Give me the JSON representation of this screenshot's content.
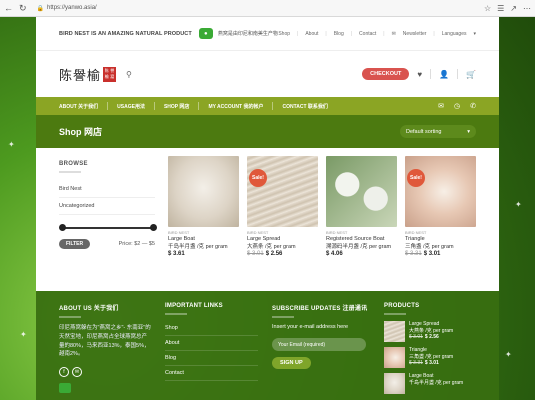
{
  "browser": {
    "url": "https://yanwo.asia/"
  },
  "topbar": {
    "promo": "BIRD NEST IS AN AMAZING NATURAL PRODUCT",
    "wechat_text": "燕窝是由印尼和南美生产物",
    "links": [
      "Shop",
      "About",
      "Blog",
      "Contact",
      "Newsletter",
      "Languages"
    ]
  },
  "header": {
    "logo_text": "陈譽榆",
    "seal_chars": [
      "陈",
      "譽",
      "榆",
      "窩"
    ],
    "checkout_label": "CHECKOUT"
  },
  "mainnav": {
    "items": [
      "ABOUT 关于我们",
      "USAGE用法",
      "SHOP 网店",
      "MY ACCOUNT 我的帐户",
      "CONTACT 联系我们"
    ]
  },
  "shop": {
    "title": "Shop 网店",
    "sort_label": "Default sorting"
  },
  "sidebar": {
    "browse_title": "BROWSE",
    "categories": [
      "Bird Nest",
      "Uncategorized"
    ],
    "filter_label": "FILTER",
    "price_text": "Price: $2 — $5"
  },
  "products": [
    {
      "category": "BIRD NEST",
      "name": "Large Boat",
      "name2": "千岛半月盏 /克 per gram",
      "old_price": "",
      "price": "$ 3.61",
      "sale": false,
      "sale_label": ""
    },
    {
      "category": "BIRD NEST",
      "name": "Large Spread",
      "name2": "大燕条 /克 per gram",
      "old_price": "$ 3.01",
      "price": "$ 2.56",
      "sale": true,
      "sale_label": "Sale!"
    },
    {
      "category": "BIRD NEST",
      "name": "Registered Source Boat",
      "name2": "溯源码半月盏 /克 per gram",
      "old_price": "",
      "price": "$ 4.06",
      "sale": false,
      "sale_label": ""
    },
    {
      "category": "BIRD NEST",
      "name": "Triangle",
      "name2": "三角盏 /克 per gram",
      "old_price": "$ 3.31",
      "price": "$ 3.01",
      "sale": true,
      "sale_label": "Sale!"
    }
  ],
  "footer": {
    "about_title": "ABOUT US 关于我们",
    "about_text": "印尼燕窝躲在为\"燕窝之乡\"- 东南亚\"的天然宝地，印尼燕窝占全球燕窝总产量的80%，马来西亚13%，泰国5%，越南2%。",
    "links_title": "IMPORTANT LINKS",
    "links": [
      "Shop",
      "About",
      "Blog",
      "Contact"
    ],
    "subscribe_title": "SUBSCRIBE UPDATES 注册通讯",
    "subscribe_text": "Insert your e-mail address here",
    "email_placeholder": "Your Email (required)",
    "signup_label": "SIGN UP",
    "products_title": "PRODUCTS",
    "products": [
      {
        "name": "Large Spread",
        "name2": "大燕条 /克 per gram",
        "old_price": "$ 3.01",
        "price": "$ 2.56"
      },
      {
        "name": "Triangle",
        "name2": "三角盏 /克 per gram",
        "old_price": "$ 3.31",
        "price": "$ 3.01"
      },
      {
        "name": "Large Boat",
        "name2": "千岛半月盏 /克 per gram",
        "old_price": "",
        "price": ""
      }
    ]
  }
}
